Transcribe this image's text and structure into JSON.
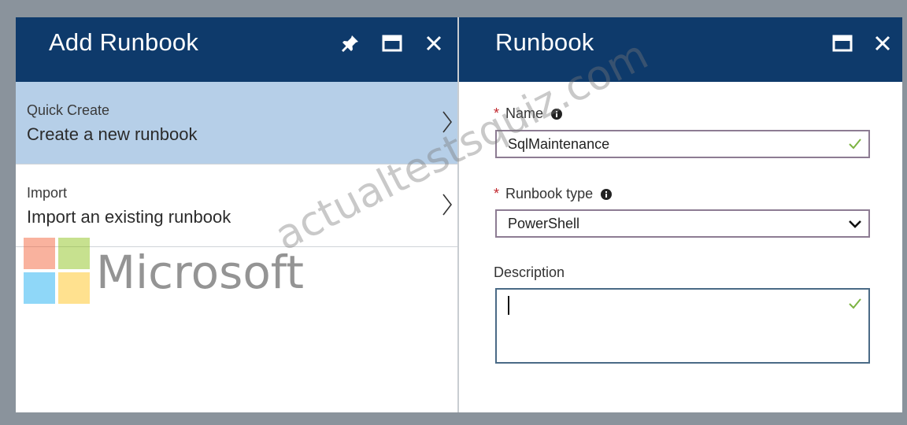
{
  "blades": {
    "add_runbook": {
      "title": "Add Runbook",
      "items": [
        {
          "category": "Quick Create",
          "label": "Create a new runbook"
        },
        {
          "category": "Import",
          "label": "Import an existing runbook"
        }
      ]
    },
    "runbook": {
      "title": "Runbook",
      "name_field": {
        "label": "Name",
        "value": "SqlMaintenance"
      },
      "type_field": {
        "label": "Runbook type",
        "value": "PowerShell"
      },
      "description_field": {
        "label": "Description",
        "value": ""
      }
    }
  },
  "icons": {
    "pin": "pin-icon",
    "maximize": "maximize-icon",
    "close": "close-icon",
    "chevron_right": "chevron-right-icon",
    "chevron_down": "chevron-down-icon",
    "info": "info-icon",
    "checkmark": "checkmark-icon"
  },
  "watermark": {
    "brand": "Microsoft",
    "site": "actualtestsquiz.com"
  },
  "colors": {
    "header": "#0e3a6b",
    "selected": "#b6cfe8",
    "required": "#c1272d",
    "valid": "#7cb342"
  }
}
